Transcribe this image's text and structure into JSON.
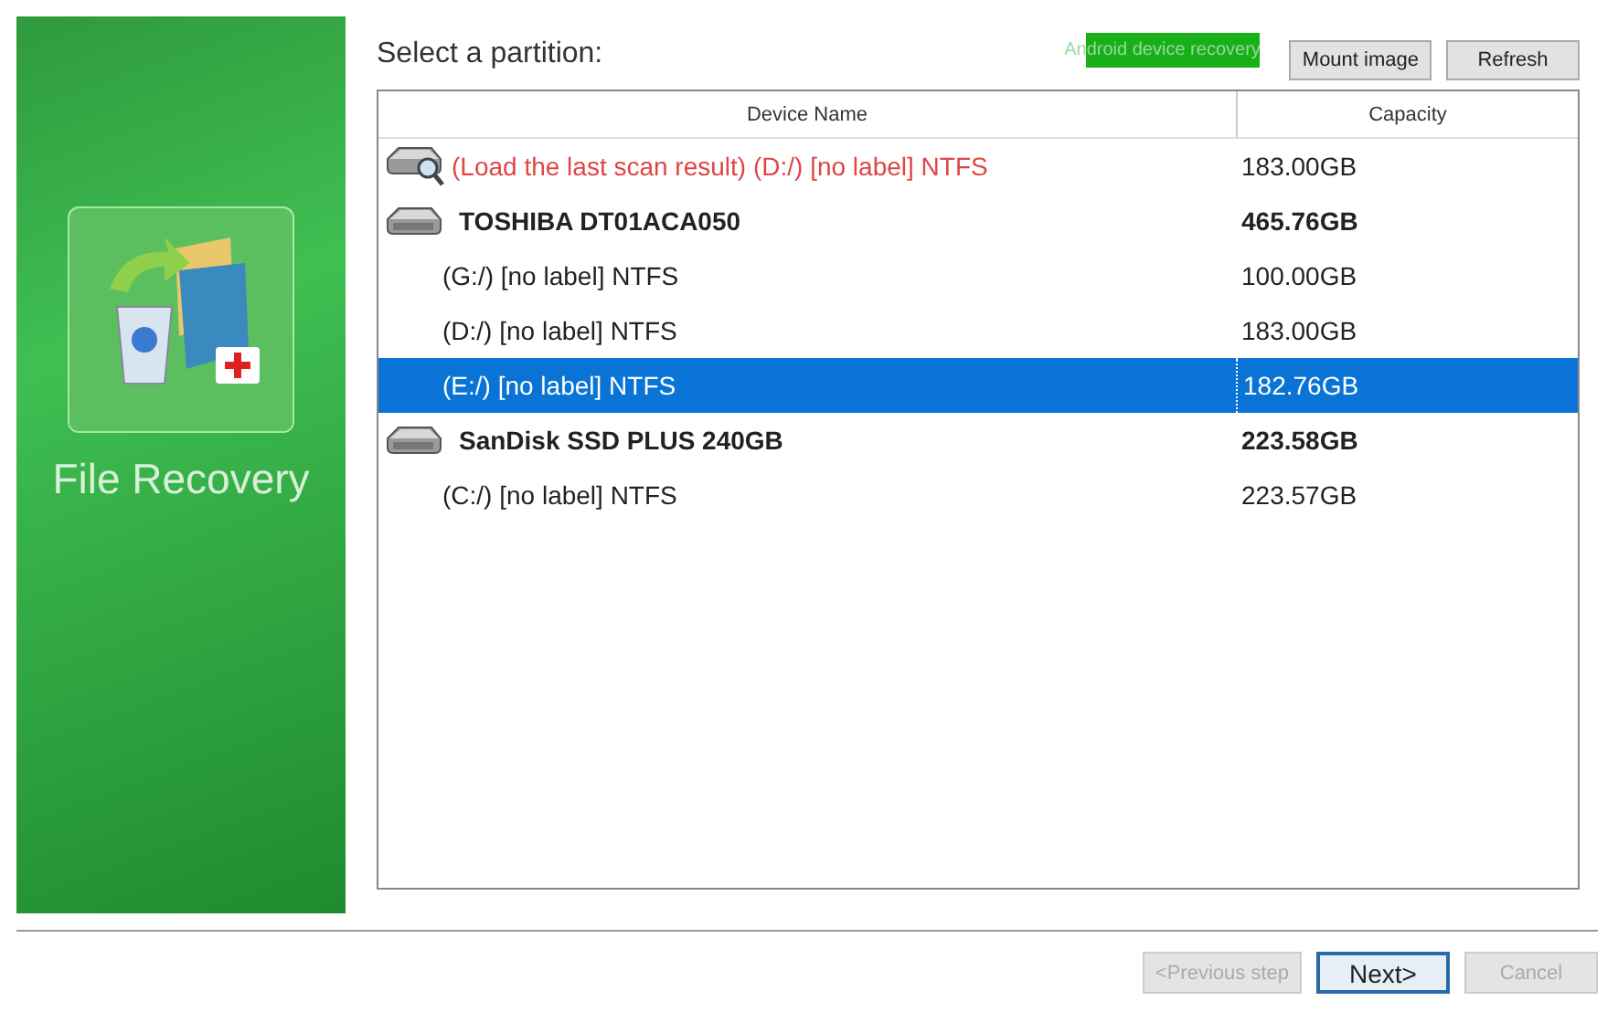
{
  "sidebar": {
    "title": "File Recovery"
  },
  "heading": "Select a partition:",
  "toolbar": {
    "link": "Android device recovery",
    "buttons": [
      {
        "label": "Mount image"
      },
      {
        "label": "Refresh"
      }
    ]
  },
  "table": {
    "columns": [
      "Device Name",
      "Capacity"
    ],
    "rows": [
      {
        "kind": "scan",
        "name": "(Load the last scan result) (D:/) [no label] NTFS",
        "capacity": "183.00GB",
        "selected": false
      },
      {
        "kind": "disk",
        "name": "TOSHIBA DT01ACA050",
        "capacity": "465.76GB",
        "selected": false
      },
      {
        "kind": "partition",
        "name": "(G:/) [no label] NTFS",
        "capacity": "100.00GB",
        "selected": false
      },
      {
        "kind": "partition",
        "name": "(D:/) [no label] NTFS",
        "capacity": "183.00GB",
        "selected": false
      },
      {
        "kind": "partition",
        "name": "(E:/) [no label] NTFS",
        "capacity": "182.76GB",
        "selected": true
      },
      {
        "kind": "disk",
        "name": "SanDisk SSD PLUS 240GB",
        "capacity": "223.58GB",
        "selected": false
      },
      {
        "kind": "partition",
        "name": "(C:/) [no label] NTFS",
        "capacity": "223.57GB",
        "selected": false
      }
    ]
  },
  "footer": {
    "buttons": [
      {
        "label": "<Previous step",
        "disabled": true
      },
      {
        "label": "Next>",
        "disabled": false
      },
      {
        "label": "Cancel",
        "disabled": true
      }
    ]
  }
}
